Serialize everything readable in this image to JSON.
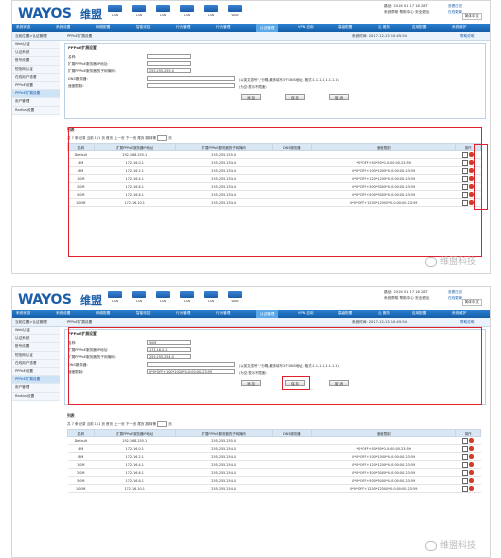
{
  "header": {
    "logo": "WAYOS",
    "logo_cn": "维盟",
    "stats": [
      {
        "label": "LAN"
      },
      {
        "label": "LAN"
      },
      {
        "label": "LAN"
      },
      {
        "label": "LAN"
      },
      {
        "label": "LAN"
      },
      {
        "label": "WAN"
      }
    ],
    "info_line1": "路径: 2016 01 17 18 28T",
    "info_line2": "系统帮助 帮助中心 安全退出",
    "info_link1": "查看日志",
    "info_link2": "在线更新",
    "lang": "简体中文"
  },
  "nav": [
    "系统状态",
    "系统设置",
    "网络配置",
    "智能流控",
    "行为管理",
    "行为管理",
    "认证管理",
    "VPN 应用",
    "高级配置",
    "云 服务",
    "应用配置",
    "系统维护"
  ],
  "subbar": {
    "left": "当前位置>认证管理",
    "mid": "PPPoE扩展设置",
    "time": "系统时间: 2017-12-13 10:45:54",
    "help": "帮助说明"
  },
  "sidebar": [
    "Web认证",
    "认证系统",
    "账号设置",
    "短信网认证",
    "在线用户查看",
    "PPPoE设置",
    "PPPoE扩展设置",
    "用户管理",
    "Radius设置"
  ],
  "form": {
    "title": "PPPoE扩展设置",
    "l_name": "名称:",
    "l_ip": "扩展PPPoE服务器IP地址:",
    "l_mask": "扩展PPPoE服务器的子网掩码:",
    "l_dns": "DNS服务器:",
    "l_rate": "速度限制:",
    "note1": "(以英文逗号\",\"分隔,最多填写3个DNS地址, 格式:1.1.1.1,1.1.1.1)",
    "note2": "(为空:表示不限速)",
    "btn_add": "添 加",
    "btn_save": "保 存",
    "btn_cancel": "取 消",
    "v1": {
      "name": "",
      "ip": "",
      "mask": "255.255.255.0",
      "dns": "",
      "rate": ""
    },
    "v2": {
      "name": "50M",
      "ip": "172.16.2.1",
      "mask": "255.255.254.0",
      "dns": "",
      "rate": "0*0*OFF+100*1000*0-0:00:00-23:59"
    }
  },
  "list": {
    "title": "列表",
    "pager": "共 7 条记录 当前 1/1 页 首页 上一页 下一页 尾页 跳转第",
    "pager_end": "页",
    "columns": [
      "名称",
      "扩展PPPoE服务器IP地址",
      "扩展PPPoE服务器的子网掩码",
      "DNS服务器",
      "速度限制",
      "操作"
    ],
    "rows": [
      {
        "name": "Default",
        "ip": "192.168.255.1",
        "mask": "255.255.255.0",
        "dns": "",
        "rate": ""
      },
      {
        "name": "4M",
        "ip": "172.16.0.1",
        "mask": "255.255.254.0",
        "dns": "",
        "rate": "*0*OFF+50*50*0-0:00:00-23:59"
      },
      {
        "name": "8M",
        "ip": "172.16.2.1",
        "mask": "255.255.254.0",
        "dns": "",
        "rate": "0*0*OFF+100*1000*0-0:00:00-23:59"
      },
      {
        "name": "10M",
        "ip": "172.16.4.1",
        "mask": "255.255.254.0",
        "dns": "",
        "rate": "0*0*OFF+120*1200*0-0:00:00-23:59"
      },
      {
        "name": "20M",
        "ip": "172.16.6.1",
        "mask": "255.255.254.0",
        "dns": "",
        "rate": "0*0*OFF+300*3000*0-0:00:00-23:59"
      },
      {
        "name": "50M",
        "ip": "172.16.8.1",
        "mask": "255.255.254.0",
        "dns": "",
        "rate": "0*0*OFF+500*5000*0-0:00:00-23:59"
      },
      {
        "name": "100M",
        "ip": "172.16.10.1",
        "mask": "255.255.254.0",
        "dns": "",
        "rate": "0*0*OFF+1250*12500*0-0:00:00-23:59"
      }
    ]
  },
  "watermark": "维盟科技",
  "colors": {
    "brand": "#1c5ea8",
    "highlight": "#e0202a",
    "nav": "#1b6dc0"
  }
}
